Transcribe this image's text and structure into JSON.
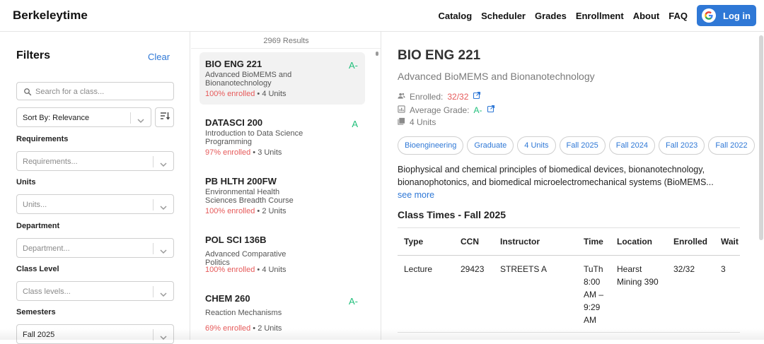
{
  "header": {
    "brand": "Berkeleytime",
    "nav": [
      "Catalog",
      "Scheduler",
      "Grades",
      "Enrollment",
      "About",
      "FAQ"
    ],
    "login_label": "Log in",
    "accent": "#2f78d6"
  },
  "filters": {
    "title": "Filters",
    "clear_label": "Clear",
    "search_placeholder": "Search for a class...",
    "sort_value": "Sort By: Relevance",
    "sections": [
      {
        "label": "Requirements",
        "placeholder": "Requirements..."
      },
      {
        "label": "Units",
        "placeholder": "Units..."
      },
      {
        "label": "Department",
        "placeholder": "Department..."
      },
      {
        "label": "Class Level",
        "placeholder": "Class levels..."
      },
      {
        "label": "Semesters",
        "value": "Fall 2025"
      }
    ]
  },
  "results": {
    "count": "2969 Results",
    "items": [
      {
        "code": "BIO ENG 221",
        "title": "Advanced BioMEMS and Bionanotechnology",
        "grade": "A-",
        "enrolled": "100% enrolled",
        "units": "• 4 Units"
      },
      {
        "code": "DATASCI 200",
        "title": "Introduction to Data Science Programming",
        "grade": "A",
        "enrolled": "97% enrolled",
        "units": "• 3 Units"
      },
      {
        "code": "PB HLTH 200FW",
        "title": "Environmental Health Sciences Breadth Course",
        "grade": "",
        "enrolled": "100% enrolled",
        "units": "• 2 Units"
      },
      {
        "code": "POL SCI 136B",
        "title": "Advanced Comparative Politics",
        "grade": "",
        "enrolled": "100% enrolled",
        "units": "• 4 Units"
      },
      {
        "code": "CHEM 260",
        "title": "Reaction Mechanisms",
        "grade": "A-",
        "enrolled": "69% enrolled",
        "units": "• 2 Units"
      }
    ]
  },
  "detail": {
    "code": "BIO ENG 221",
    "title": "Advanced BioMEMS and Bionanotechnology",
    "enrolled_label": "Enrolled:",
    "enrolled_value": "32/32",
    "grade_label": "Average Grade:",
    "grade_value": "A-",
    "units": "4 Units",
    "tags": [
      "Bioengineering",
      "Graduate",
      "4 Units",
      "Fall 2025",
      "Fall 2024",
      "Fall 2023",
      "Fall 2022"
    ],
    "description": "Biophysical and chemical principles of biomedical devices, bionanotechnology, bionanophotonics, and biomedical microelectromechanical systems (BioMEMS...",
    "see_more": "see more",
    "class_times_title": "Class Times - Fall 2025",
    "table": {
      "headers": [
        "Type",
        "CCN",
        "Instructor",
        "Time",
        "Location",
        "Enrolled",
        "Wait"
      ],
      "row": [
        "Lecture",
        "29423",
        "STREETS A",
        "TuTh 8:00 AM – 9:29 AM",
        "Hearst Mining 390",
        "32/32",
        "3"
      ]
    }
  }
}
